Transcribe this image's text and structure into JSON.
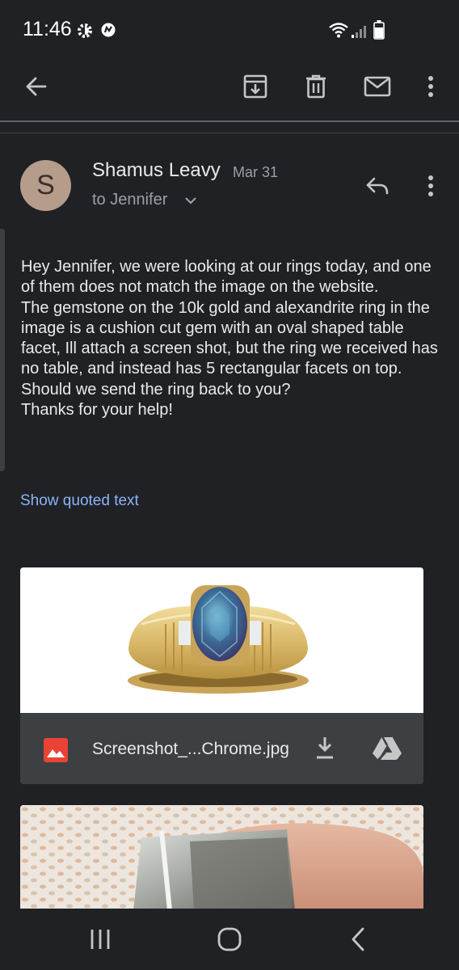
{
  "status_bar": {
    "time": "11:46"
  },
  "toolbar": {
    "icons": [
      "back-arrow-icon",
      "archive-icon",
      "delete-icon",
      "mark-unread-icon",
      "more-vert-icon"
    ]
  },
  "message": {
    "avatar_letter": "S",
    "sender_name": "Shamus Leavy",
    "date": "Mar 31",
    "recipient": "to Jennifer",
    "body_paragraphs": [
      "Hey Jennifer, we were looking at our rings today, and one of them does not match the image on the website.",
      "The gemstone on the 10k gold and alexandrite ring in the image is a cushion cut gem with an oval shaped table facet, Ill attach a screen shot, but the ring we received has no table, and instead has 5 rectangular facets on top. Should we send the ring back to you?",
      "Thanks for your help!"
    ],
    "show_quoted_label": "Show quoted text"
  },
  "attachments": [
    {
      "filename": "Screenshot_...Chrome.jpg",
      "type_icon": "image-file-icon",
      "actions": [
        "download-icon",
        "drive-icon"
      ]
    }
  ],
  "colors": {
    "background": "#202124",
    "text_primary": "#e8eaed",
    "text_secondary": "#9aa0a6",
    "link": "#8ab4f8",
    "avatar": "#b59c8b",
    "attachment_footer": "#3c4043",
    "image_file_icon": "#ea4335"
  }
}
